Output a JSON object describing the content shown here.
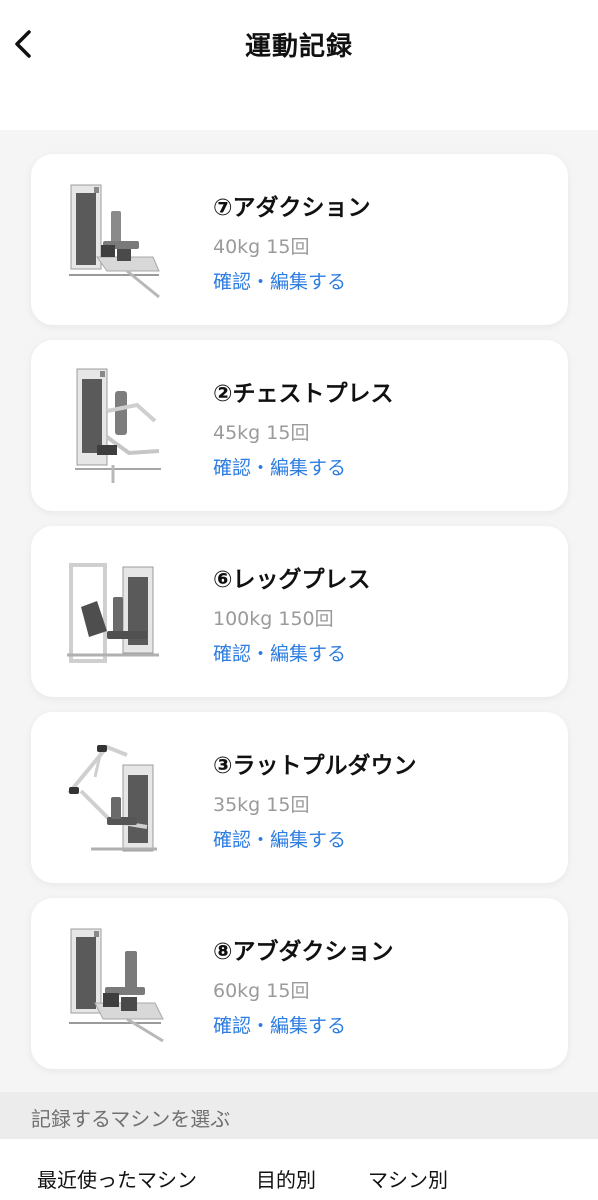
{
  "header": {
    "title": "運動記録",
    "back_icon": "chevron-left-icon"
  },
  "records": [
    {
      "title": "⑦アダクション",
      "detail": "40kg 15回",
      "link": "確認・編集する"
    },
    {
      "title": "②チェストプレス",
      "detail": "45kg 15回",
      "link": "確認・編集する"
    },
    {
      "title": "⑥レッグプレス",
      "detail": "100kg 150回",
      "link": "確認・編集する"
    },
    {
      "title": "③ラットプルダウン",
      "detail": "35kg 15回",
      "link": "確認・編集する"
    },
    {
      "title": "⑧アブダクション",
      "detail": "60kg 15回",
      "link": "確認・編集する"
    }
  ],
  "select_section": {
    "label": "記録するマシンを選ぶ"
  },
  "tabs": [
    {
      "label": "最近使ったマシン"
    },
    {
      "label": "目的別"
    },
    {
      "label": "マシン別"
    }
  ],
  "colors": {
    "link": "#2d7de0",
    "background": "#f5f5f5",
    "card": "#ffffff",
    "muted_text": "#9a9a9a"
  }
}
